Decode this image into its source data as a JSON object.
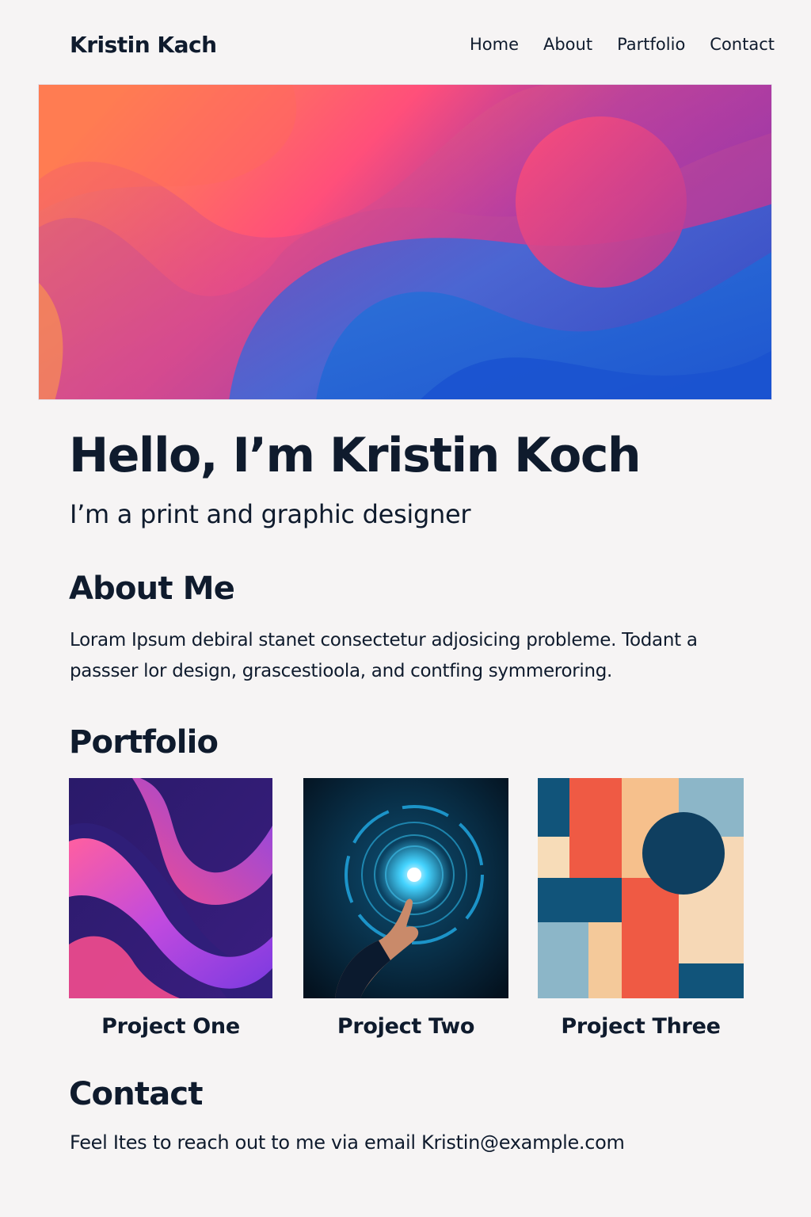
{
  "header": {
    "brand": "Kristin Kach",
    "nav": [
      "Home",
      "About",
      "Partfolio",
      "Contact"
    ]
  },
  "hero": {
    "colors": [
      "#ff8a4c",
      "#ff4f7a",
      "#a638a6",
      "#7a2fb0",
      "#3a5fd8",
      "#1f5bd6"
    ]
  },
  "intro": {
    "heading": "Hello, I’m Kristin Koch",
    "tagline": "I’m a print and graphic designer"
  },
  "about": {
    "title": "About Me",
    "text": "Loram Ipsum debiral stanet consectetur adjosicing probleme. Todant a passser lor design, grascestioola, and contfing symmeroring."
  },
  "portfolio": {
    "title": "Portfolio",
    "projects": [
      {
        "title": "Project One",
        "image": "abstract-purple-ribbon"
      },
      {
        "title": "Project Two",
        "image": "hand-touching-digital-circle"
      },
      {
        "title": "Project Three",
        "image": "geometric-color-blocks"
      }
    ]
  },
  "contact": {
    "title": "Contact",
    "text": "Feel Ites to reach out to me via email",
    "email": "Kristin@example.com"
  }
}
